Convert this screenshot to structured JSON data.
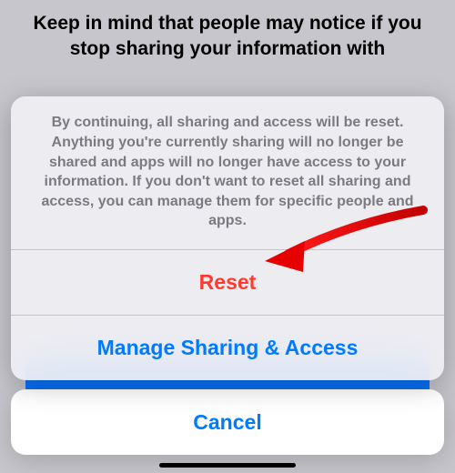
{
  "background": {
    "partial_text": "Keep in mind that people may notice if you stop sharing your information with"
  },
  "sheet": {
    "message": "By continuing, all sharing and access will be reset. Anything you're currently sharing will no longer be shared and apps will no longer have access to your information. If you don't want to reset all sharing and access, you can manage them for specific people and apps.",
    "reset_label": "Reset",
    "manage_label": "Manage Sharing & Access",
    "cancel_label": "Cancel"
  },
  "colors": {
    "destructive": "#ff3b30",
    "accent": "#007aff"
  },
  "annotation": {
    "kind": "red-arrow",
    "target": "reset-button"
  }
}
